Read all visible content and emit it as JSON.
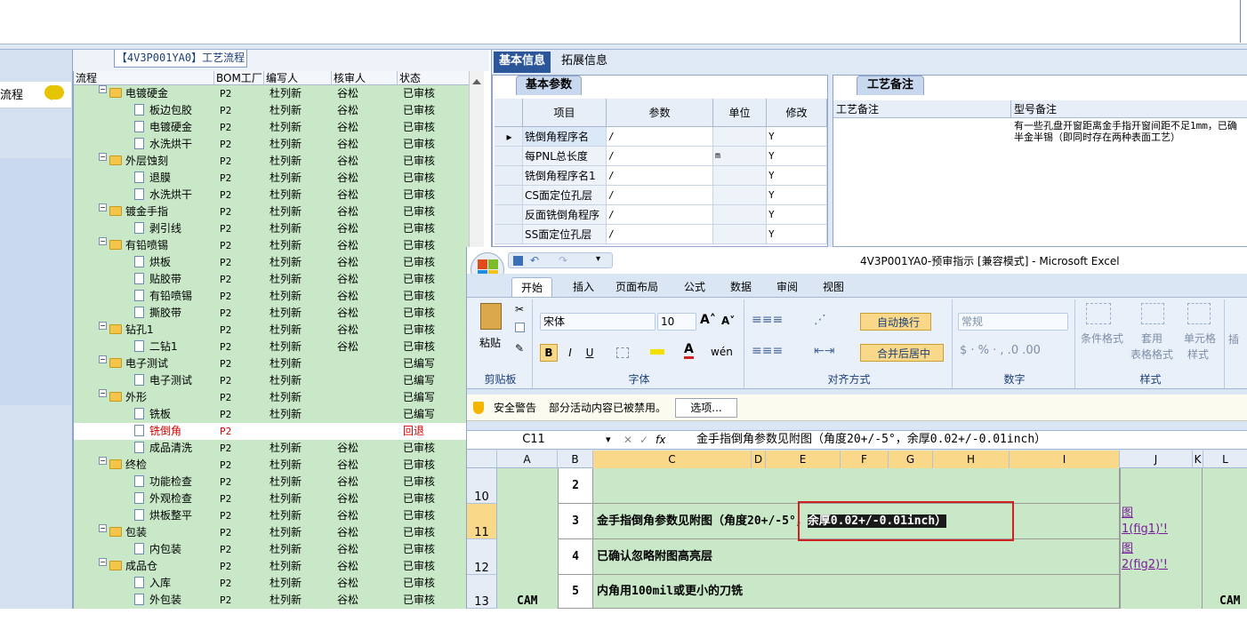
{
  "left_strip": {
    "item_label": "流程"
  },
  "tree": {
    "title": "【4V3P001YA0】工艺流程",
    "columns": [
      "流程",
      "BOM工厂",
      "编写人",
      "核审人",
      "状态"
    ],
    "rows": [
      {
        "name": "电镀硬金",
        "bom": "P2",
        "writer": "杜列新",
        "reviewer": "谷松",
        "status": "已审核",
        "level": 0,
        "type": "folder"
      },
      {
        "name": "板边包胶",
        "bom": "P2",
        "writer": "杜列新",
        "reviewer": "谷松",
        "status": "已审核",
        "level": 1,
        "type": "doc"
      },
      {
        "name": "电镀硬金",
        "bom": "P2",
        "writer": "杜列新",
        "reviewer": "谷松",
        "status": "已审核",
        "level": 1,
        "type": "doc"
      },
      {
        "name": "水洗烘干",
        "bom": "P2",
        "writer": "杜列新",
        "reviewer": "谷松",
        "status": "已审核",
        "level": 1,
        "type": "doc"
      },
      {
        "name": "外层蚀刻",
        "bom": "P2",
        "writer": "杜列新",
        "reviewer": "谷松",
        "status": "已审核",
        "level": 0,
        "type": "folder"
      },
      {
        "name": "退膜",
        "bom": "P2",
        "writer": "杜列新",
        "reviewer": "谷松",
        "status": "已审核",
        "level": 1,
        "type": "doc"
      },
      {
        "name": "水洗烘干",
        "bom": "P2",
        "writer": "杜列新",
        "reviewer": "谷松",
        "status": "已审核",
        "level": 1,
        "type": "doc"
      },
      {
        "name": "镀金手指",
        "bom": "P2",
        "writer": "杜列新",
        "reviewer": "谷松",
        "status": "已审核",
        "level": 0,
        "type": "folder"
      },
      {
        "name": "剥引线",
        "bom": "P2",
        "writer": "杜列新",
        "reviewer": "谷松",
        "status": "已审核",
        "level": 1,
        "type": "doc"
      },
      {
        "name": "有铅喷锡",
        "bom": "P2",
        "writer": "杜列新",
        "reviewer": "谷松",
        "status": "已审核",
        "level": 0,
        "type": "folder"
      },
      {
        "name": "烘板",
        "bom": "P2",
        "writer": "杜列新",
        "reviewer": "谷松",
        "status": "已审核",
        "level": 1,
        "type": "doc"
      },
      {
        "name": "贴胶带",
        "bom": "P2",
        "writer": "杜列新",
        "reviewer": "谷松",
        "status": "已审核",
        "level": 1,
        "type": "doc"
      },
      {
        "name": "有铅喷锡",
        "bom": "P2",
        "writer": "杜列新",
        "reviewer": "谷松",
        "status": "已审核",
        "level": 1,
        "type": "doc"
      },
      {
        "name": "撕胶带",
        "bom": "P2",
        "writer": "杜列新",
        "reviewer": "谷松",
        "status": "已审核",
        "level": 1,
        "type": "doc"
      },
      {
        "name": "钻孔1",
        "bom": "P2",
        "writer": "杜列新",
        "reviewer": "谷松",
        "status": "已审核",
        "level": 0,
        "type": "folder"
      },
      {
        "name": "二钻1",
        "bom": "P2",
        "writer": "杜列新",
        "reviewer": "谷松",
        "status": "已审核",
        "level": 1,
        "type": "doc"
      },
      {
        "name": "电子测试",
        "bom": "P2",
        "writer": "杜列新",
        "reviewer": "",
        "status": "已编写",
        "level": 0,
        "type": "folder"
      },
      {
        "name": "电子测试",
        "bom": "P2",
        "writer": "杜列新",
        "reviewer": "",
        "status": "已编写",
        "level": 1,
        "type": "doc"
      },
      {
        "name": "外形",
        "bom": "P2",
        "writer": "杜列新",
        "reviewer": "",
        "status": "已编写",
        "level": 0,
        "type": "folder"
      },
      {
        "name": "铣板",
        "bom": "P2",
        "writer": "杜列新",
        "reviewer": "",
        "status": "已编写",
        "level": 1,
        "type": "doc"
      },
      {
        "name": "铣倒角",
        "bom": "P2",
        "writer": "",
        "reviewer": "",
        "status": "回退",
        "level": 1,
        "type": "doc",
        "selected": true
      },
      {
        "name": "成品清洗",
        "bom": "P2",
        "writer": "杜列新",
        "reviewer": "谷松",
        "status": "已审核",
        "level": 1,
        "type": "doc"
      },
      {
        "name": "终检",
        "bom": "P2",
        "writer": "杜列新",
        "reviewer": "谷松",
        "status": "已审核",
        "level": 0,
        "type": "folder"
      },
      {
        "name": "功能检查",
        "bom": "P2",
        "writer": "杜列新",
        "reviewer": "谷松",
        "status": "已审核",
        "level": 1,
        "type": "doc"
      },
      {
        "name": "外观检查",
        "bom": "P2",
        "writer": "杜列新",
        "reviewer": "谷松",
        "status": "已审核",
        "level": 1,
        "type": "doc"
      },
      {
        "name": "烘板整平",
        "bom": "P2",
        "writer": "杜列新",
        "reviewer": "谷松",
        "status": "已审核",
        "level": 1,
        "type": "doc"
      },
      {
        "name": "包装",
        "bom": "P2",
        "writer": "杜列新",
        "reviewer": "谷松",
        "status": "已审核",
        "level": 0,
        "type": "folder"
      },
      {
        "name": "内包装",
        "bom": "P2",
        "writer": "杜列新",
        "reviewer": "谷松",
        "status": "已审核",
        "level": 1,
        "type": "doc"
      },
      {
        "name": "成品仓",
        "bom": "P2",
        "writer": "杜列新",
        "reviewer": "谷松",
        "status": "已审核",
        "level": 0,
        "type": "folder"
      },
      {
        "name": "入库",
        "bom": "P2",
        "writer": "杜列新",
        "reviewer": "谷松",
        "status": "已审核",
        "level": 1,
        "type": "doc"
      },
      {
        "name": "外包装",
        "bom": "P2",
        "writer": "杜列新",
        "reviewer": "谷松",
        "status": "已审核",
        "level": 1,
        "type": "doc"
      }
    ]
  },
  "right_panel": {
    "tabs": [
      "基本信息",
      "拓展信息"
    ],
    "basic_group_title": "基本参数",
    "param_columns": [
      "项目",
      "参数",
      "单位",
      "修改"
    ],
    "params": [
      {
        "item": "铣倒角程序名",
        "value": "/",
        "unit": "",
        "edit": "Y"
      },
      {
        "item": "每PNL总长度",
        "value": "/",
        "unit": "m",
        "edit": "Y"
      },
      {
        "item": "铣倒角程序名1",
        "value": "/",
        "unit": "",
        "edit": "Y"
      },
      {
        "item": "CS面定位孔层",
        "value": "/",
        "unit": "",
        "edit": "Y"
      },
      {
        "item": "反面铣倒角程序",
        "value": "/",
        "unit": "",
        "edit": "Y"
      },
      {
        "item": "SS面定位孔层",
        "value": "/",
        "unit": "",
        "edit": "Y"
      }
    ],
    "note_group_title": "工艺备注",
    "note_columns": [
      "工艺备注",
      "型号备注"
    ],
    "model_note_line1": "有一些孔盘开窗距离金手指开窗间距不足1mm，已确",
    "model_note_line2": "半金半锡（即同时存在两种表面工艺）"
  },
  "excel": {
    "title": "4V3P001YA0-预审指示 [兼容模式] - Microsoft Excel",
    "ribbon_tabs": [
      "开始",
      "插入",
      "页面布局",
      "公式",
      "数据",
      "审阅",
      "视图"
    ],
    "paste_label": "粘贴",
    "clipboard_label": "剪贴板",
    "font_name": "宋体",
    "font_size": "10",
    "font_group_label": "字体",
    "wrap_text": "自动换行",
    "merge_center": "合并后居中",
    "align_group_label": "对齐方式",
    "number_format": "常规",
    "number_group_label": "数字",
    "cond_format": "条件格式",
    "table_format_1": "套用",
    "table_format_2": "表格格式",
    "cell_style_1": "单元格",
    "cell_style_2": "样式",
    "insert_label": "插",
    "style_group_label": "样式",
    "security_warning": "安全警告",
    "security_msg": "部分活动内容已被禁用。",
    "options_button": "选项...",
    "name_box": "C11",
    "formula": "金手指倒角参数见附图（角度20+/-5°，余厚0.02+/-0.01inch）",
    "columns": [
      "A",
      "B",
      "C",
      "D",
      "E",
      "F",
      "G",
      "H",
      "I",
      "J",
      "K",
      "L"
    ],
    "rows": [
      {
        "num": "10",
        "b": "2",
        "c": "",
        "j": ""
      },
      {
        "num": "11",
        "b": "3",
        "c": "金手指倒角参数见附图（角度20+/-5°，",
        "c_hl": "余厚0.02+/-0.01inch）",
        "j1": "图",
        "j2": "1(fig1)'!"
      },
      {
        "num": "12",
        "b": "4",
        "c": "已确认忽略附图高亮层",
        "j1": "图",
        "j2": "2(fig2)'!"
      },
      {
        "num": "13",
        "b": "5",
        "c": "内角用100mil或更小的刀铣",
        "j1": "",
        "j2": ""
      }
    ],
    "a_label": "CAM",
    "l_label": "CAM"
  }
}
